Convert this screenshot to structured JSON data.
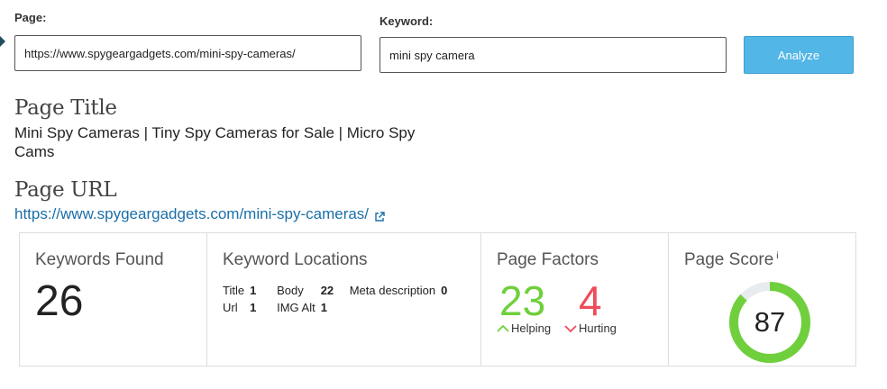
{
  "form": {
    "page_label": "Page:",
    "page_value": "https://www.spygeargadgets.com/mini-spy-cameras/",
    "keyword_label": "Keyword:",
    "keyword_value": "mini spy camera",
    "analyze_label": "Analyze"
  },
  "page_title": {
    "heading": "Page Title",
    "value": "Mini Spy Cameras | Tiny Spy Cameras for Sale | Micro Spy Cams"
  },
  "page_url": {
    "heading": "Page URL",
    "value": "https://www.spygeargadgets.com/mini-spy-cameras/",
    "icon": "external-link-icon"
  },
  "stats": {
    "keywords_found": {
      "title": "Keywords Found",
      "value": "26"
    },
    "keyword_locations": {
      "title": "Keyword Locations",
      "items": [
        {
          "label": "Title",
          "value": "1"
        },
        {
          "label": "Body",
          "value": "22"
        },
        {
          "label": "Meta description",
          "value": "0"
        },
        {
          "label": "Url",
          "value": "1"
        },
        {
          "label": "IMG Alt",
          "value": "1"
        }
      ]
    },
    "page_factors": {
      "title": "Page Factors",
      "helping_value": "23",
      "helping_label": "Helping",
      "hurting_value": "4",
      "hurting_label": "Hurting",
      "helping_color": "#6fcf3c",
      "hurting_color": "#ee4d5a"
    },
    "page_score": {
      "title": "Page Score",
      "info": "i",
      "value": "87",
      "fraction": 0.87,
      "ring_color": "#6fcf3c",
      "track_color": "#e9ecef"
    }
  },
  "colors": {
    "button_bg": "#52b6e6",
    "link": "#1a6fa8"
  }
}
